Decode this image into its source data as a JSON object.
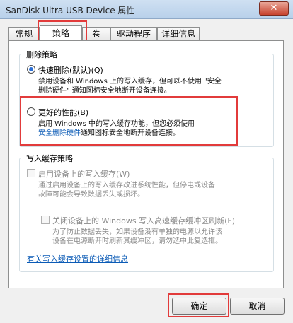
{
  "window": {
    "title": "SanDisk Ultra USB Device 属性",
    "close_glyph": "✕"
  },
  "tabs": [
    {
      "label": "常规"
    },
    {
      "label": "策略"
    },
    {
      "label": "卷"
    },
    {
      "label": "驱动程序"
    },
    {
      "label": "详细信息"
    }
  ],
  "removal_policy": {
    "title": "删除策略",
    "quick": {
      "label": "快速删除(默认)(Q)",
      "desc_line1": "禁用设备和 Windows 上的写入缓存，但可以不使用 \"安全",
      "desc_line2": "删除硬件\" 通知图标安全地断开设备连接。"
    },
    "better": {
      "label": "更好的性能(B)",
      "desc_line1": "启用 Windows 中的写入缓存功能，但您必须使用",
      "desc_link": "安全删除硬件",
      "desc_line2_rest": "通知图标安全地断开设备连接。"
    }
  },
  "write_cache": {
    "title": "写入缓存策略",
    "enable": {
      "label": "启用设备上的写入缓存(W)",
      "desc_line1": "通过启用设备上的写入缓存改进系统性能，但停电或设备",
      "desc_line2": "故障可能会导致数据丢失或损坏。"
    },
    "flush": {
      "label": "关闭设备上的 Windows 写入高速缓存缓冲区刷新(F)",
      "desc_line1": "为了防止数据丢失，如果设备没有单独的电源以允许该",
      "desc_line2": "设备在电源断开时刷新其缓冲区，请勿选中此复选框。"
    },
    "details_link": "有关写入缓存设置的详细信息"
  },
  "buttons": {
    "ok": "确定",
    "cancel": "取消"
  },
  "colors": {
    "highlight": "#e23b3b",
    "link": "#0b5bb6",
    "radio_dot": "#2b6fd6"
  }
}
